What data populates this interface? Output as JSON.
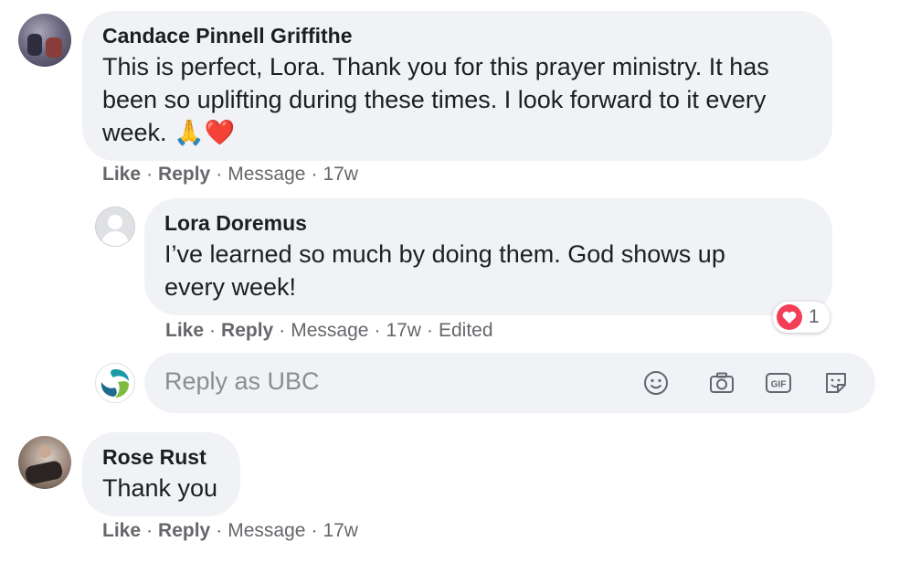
{
  "comments": [
    {
      "author": "Candace Pinnell Griffithe",
      "text_lines": [
        "This is perfect, Lora. Thank you for this prayer ministry. It has",
        "been so uplifting during these times. I look forward to it every",
        "week."
      ],
      "emojis": "🙏❤️",
      "actions": {
        "like": "Like",
        "reply": "Reply",
        "message": "Message",
        "time": "17w"
      }
    },
    {
      "author": "Lora Doremus",
      "text_lines": [
        "I’ve learned so much by doing them. God shows up",
        "every week!"
      ],
      "reaction_count": "1",
      "actions": {
        "like": "Like",
        "reply": "Reply",
        "message": "Message",
        "time": "17w",
        "edited": "Edited"
      }
    },
    {
      "author": "Rose Rust",
      "text_lines": [
        "Thank you"
      ],
      "actions": {
        "like": "Like",
        "reply": "Reply",
        "message": "Message",
        "time": "17w"
      }
    }
  ],
  "reply_box": {
    "placeholder": "Reply as UBC",
    "icons": [
      "emoji-icon",
      "camera-icon",
      "gif-icon",
      "sticker-icon"
    ]
  },
  "separator": "·",
  "colors": {
    "bubble": "#f0f2f5",
    "meta": "#65676b",
    "heart": "#f33e58"
  }
}
